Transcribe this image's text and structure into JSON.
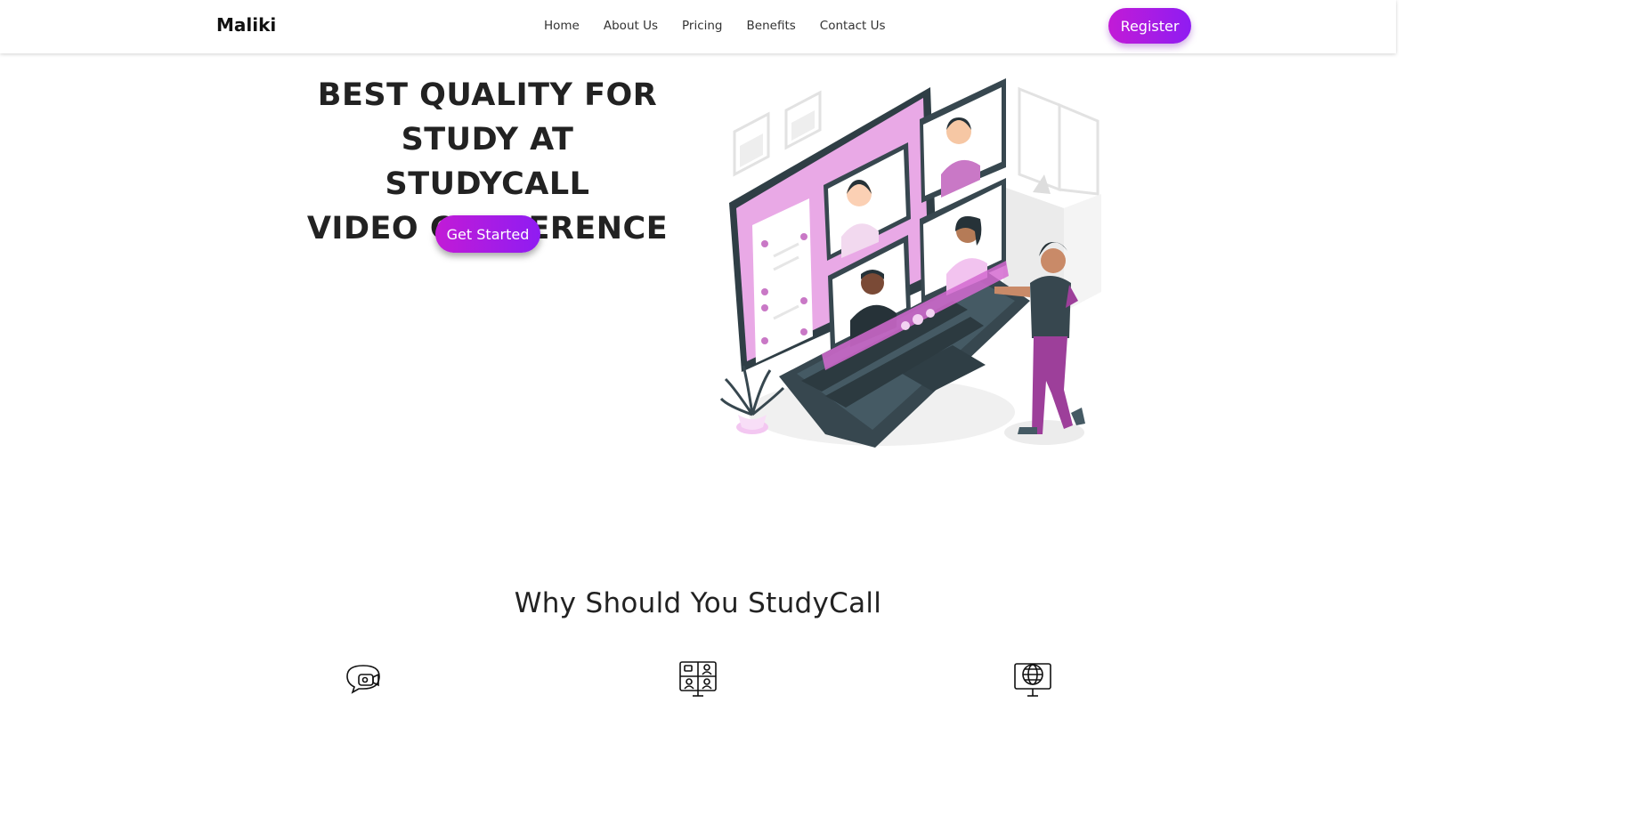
{
  "brand": "Maliki",
  "nav": {
    "items": [
      "Home",
      "About Us",
      "Pricing",
      "Benefits",
      "Contact Us"
    ],
    "register_label": "Register"
  },
  "hero": {
    "title_lines": [
      "BEST QUALITY FOR",
      "STUDY AT STUDYCALL",
      "VIDEO CONFERENCE"
    ],
    "cta_label": "Get Started"
  },
  "features": {
    "title": "Why Should You StudyCall",
    "icons": [
      "video-chat-icon",
      "video-conference-grid-icon",
      "global-monitor-icon"
    ]
  },
  "colors": {
    "accent_start": "#c21bd6",
    "accent_end": "#8f1cf2",
    "illustration_purple": "#e9a9e6",
    "illustration_dark": "#37474f"
  }
}
